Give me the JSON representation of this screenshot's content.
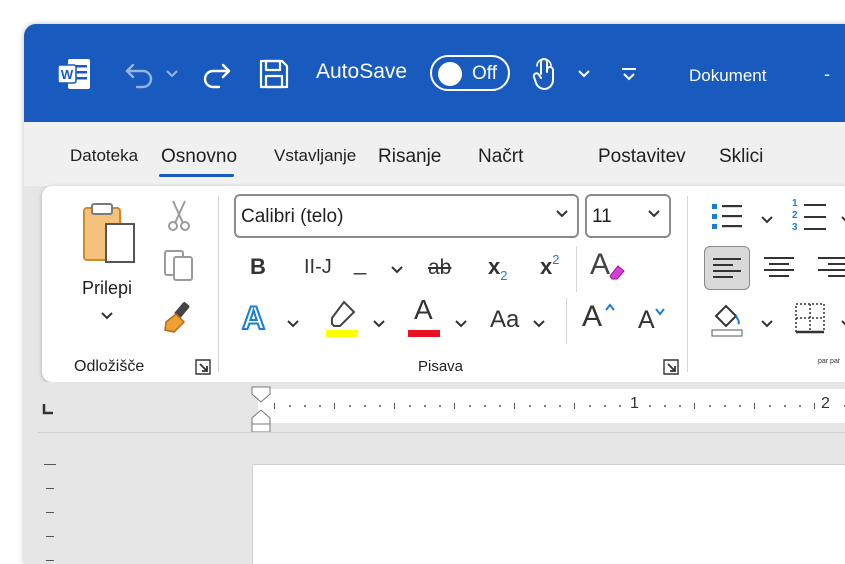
{
  "titlebar": {
    "autosave_label": "AutoSave",
    "autosave_state": "Off",
    "document_title": "Dokument",
    "minimize_glyph": "-",
    "bg_color": "#185abd"
  },
  "tabs": [
    {
      "label": "Datoteka"
    },
    {
      "label": "Osnovno",
      "active": true
    },
    {
      "label": "Vstavljanje"
    },
    {
      "label": "Risanje"
    },
    {
      "label": "Načrt"
    },
    {
      "label": "Postavitev"
    },
    {
      "label": "Sklici"
    }
  ],
  "clipboard": {
    "paste_label": "Prilepi",
    "group_label": "Odložišče"
  },
  "font": {
    "font_name": "Calibri (telo)",
    "font_size": "11",
    "bold_glyph": "B",
    "italic_glyph": "II-J",
    "underline_glyph": "_",
    "strike_glyph": "ab",
    "subscript_glyph": "x",
    "subscript_sub": "2",
    "superscript_glyph": "x",
    "superscript_sup": "2",
    "clear_glyph": "A",
    "effects_glyph": "A",
    "fontcolor_glyph": "A",
    "case_glyph": "Aa",
    "grow_glyph": "A",
    "shrink_glyph": "A",
    "group_label": "Pisava",
    "highlight_color": "#ffff00",
    "font_color": "#e81123"
  },
  "paragraph": {
    "list_number_1": "1",
    "list_number_2": "2",
    "list_number_3": "3",
    "group_label_partial": "par par"
  },
  "ruler": {
    "number_1": "1",
    "number_2": "2"
  }
}
